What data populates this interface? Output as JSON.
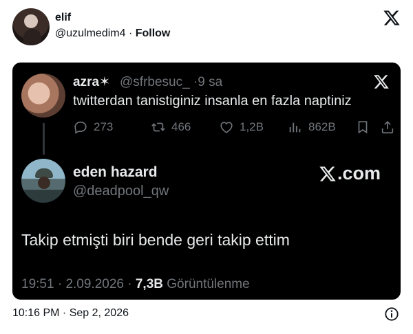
{
  "embed": {
    "author_name": "elif",
    "author_handle": "@uzulmedim4",
    "separator": " · ",
    "follow_label": "Follow",
    "timestamp": "10:16 PM · Sep 2, 2026"
  },
  "quoted_tweet": {
    "author_name": "azra✶",
    "author_handle": "@sfrbesuc_",
    "time_ago": "9 sa",
    "text": "twitterdan tanistiginiz insanla en fazla naptiniz",
    "replies": "273",
    "retweets": "466",
    "likes": "1,2B",
    "views": "862B"
  },
  "main_tweet": {
    "author_name": "eden hazard",
    "author_handle": "@deadpool_qw",
    "brand_text": ".com",
    "text": "Takip etmişti biri bende geri takip ettim",
    "time": "19:51",
    "date": "2.09.2026",
    "views_count": "7,3B",
    "views_label": "Görüntülenme"
  },
  "colors": {
    "card_background": "#000000",
    "primary_text_dark": "#e7e9ea",
    "secondary_text_dark": "#71767b",
    "text_light": "#0f1419"
  },
  "icons": [
    "x-logo-icon",
    "reply-icon",
    "retweet-icon",
    "like-icon",
    "views-icon",
    "bookmark-icon",
    "share-icon",
    "info-icon"
  ]
}
